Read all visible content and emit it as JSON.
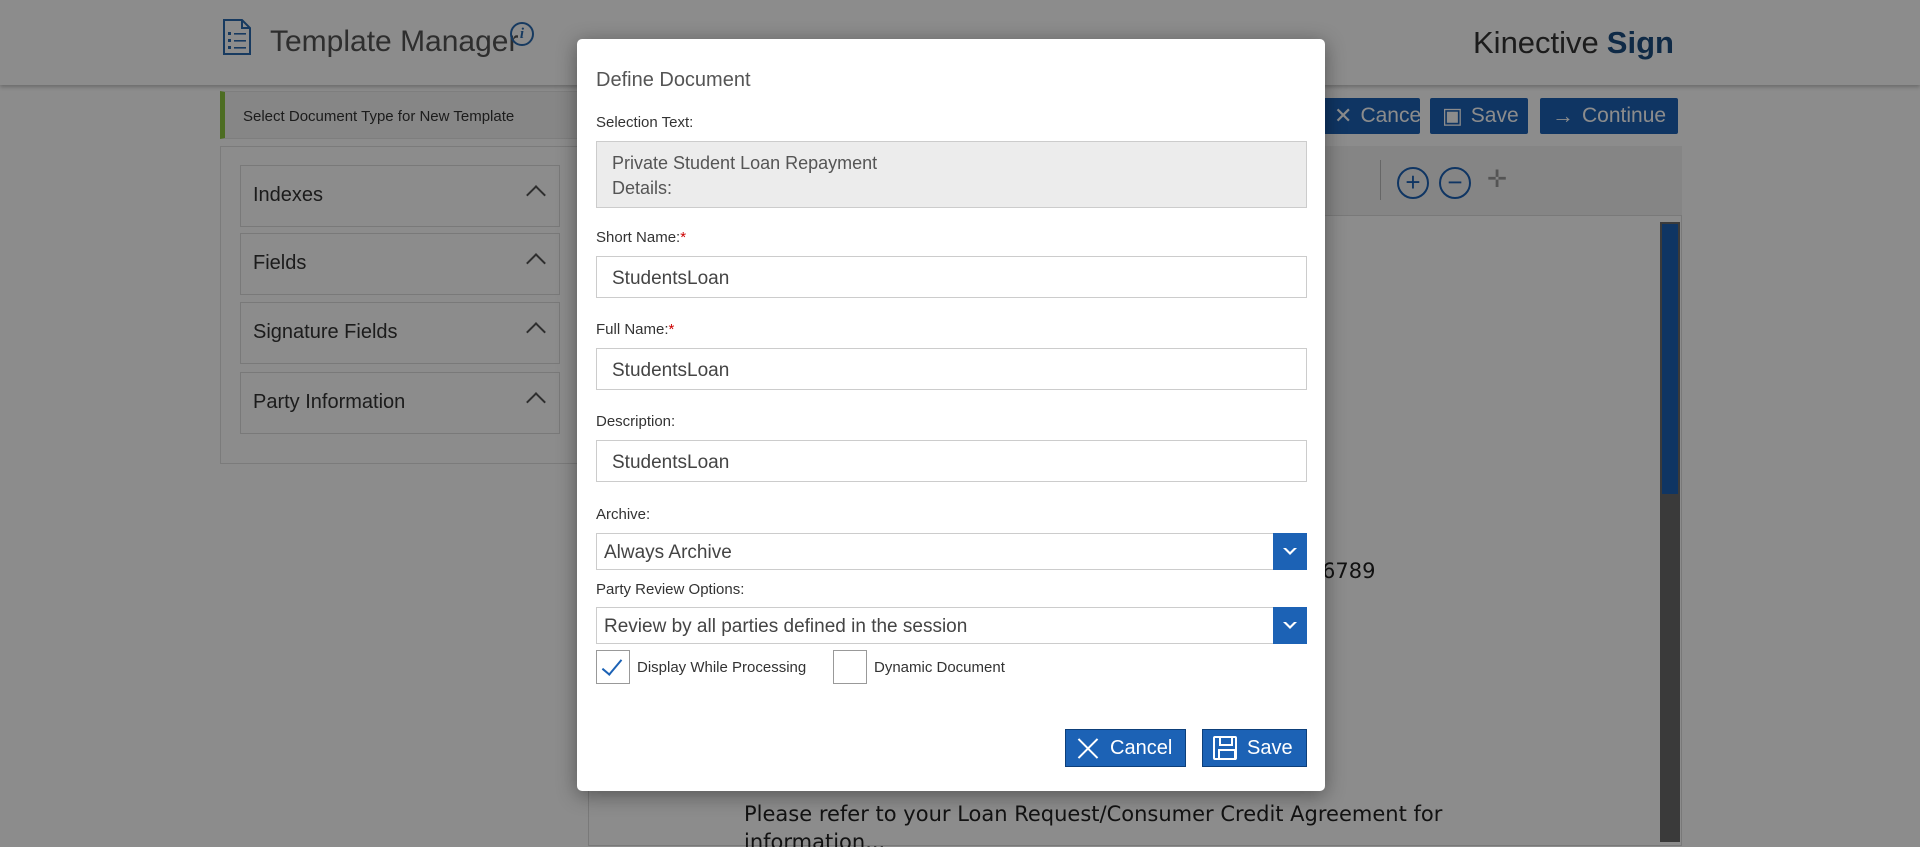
{
  "header": {
    "title": "Template Manager",
    "brand_prefix": "Kinective",
    "brand_bold": "Sign"
  },
  "doctype_bar": {
    "text": "Select Document Type for New Template"
  },
  "toolbar": {
    "cancel_label": "Cancel",
    "save_label": "Save",
    "continue_label": "Continue"
  },
  "sidebar": {
    "sections": [
      {
        "label": "Indexes"
      },
      {
        "label": "Fields"
      },
      {
        "label": "Signature Fields"
      },
      {
        "label": "Party Information"
      }
    ]
  },
  "document": {
    "partial_number": "6789",
    "line1": "Please refer to your Loan Request/Consumer Credit Agreement for",
    "line2": "information..."
  },
  "modal": {
    "title": "Define Document",
    "selection_text_label": "Selection Text:",
    "selection_text_line1": "Private Student Loan Repayment",
    "selection_text_line2": "Details:",
    "short_name_label": "Short Name:",
    "short_name_value": "StudentsLoan",
    "full_name_label": "Full Name:",
    "full_name_value": "StudentsLoan",
    "required_marker": "*",
    "description_label": "Description:",
    "description_value": "StudentsLoan",
    "archive_label": "Archive:",
    "archive_value": "Always Archive",
    "party_review_label": "Party Review Options:",
    "party_review_value": "Review by all parties defined in the session",
    "display_while_processing_label": "Display While Processing",
    "display_while_processing_checked": true,
    "dynamic_document_label": "Dynamic Document",
    "dynamic_document_checked": false,
    "cancel_label": "Cancel",
    "save_label": "Save"
  },
  "colors": {
    "accent": "#1c62b5",
    "brand_dark": "#1c4d80",
    "doctype_marker": "#8cc63f",
    "required": "#cc0000"
  }
}
